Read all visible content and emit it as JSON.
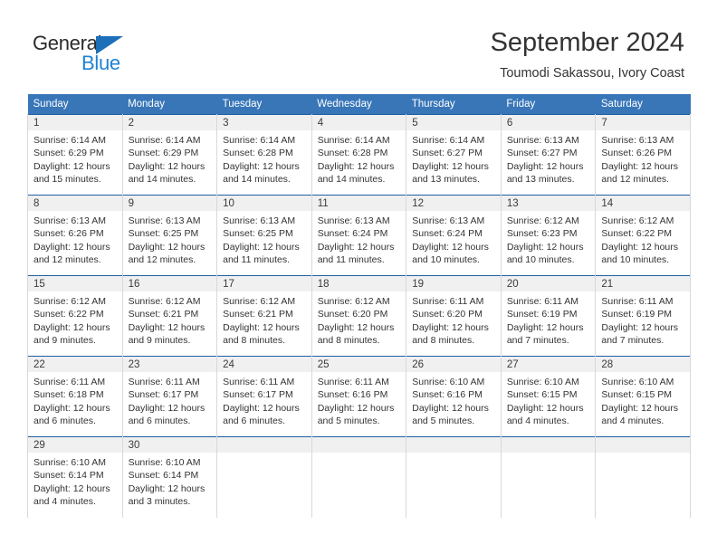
{
  "brand": {
    "name_part1": "General",
    "name_part2": "Blue",
    "color_dark": "#2b2b2b",
    "color_blue": "#2083d4",
    "triangle_color": "#1c6fb8"
  },
  "header": {
    "title": "September 2024",
    "subtitle": "Toumodi Sakassou, Ivory Coast"
  },
  "theme": {
    "header_row_bg": "#3876b8",
    "header_row_text": "#ffffff",
    "daynum_bg": "#f0f0f0",
    "cell_border": "#d8d8d8",
    "week_top_border": "#1f5fa0"
  },
  "weekday_headers": [
    "Sunday",
    "Monday",
    "Tuesday",
    "Wednesday",
    "Thursday",
    "Friday",
    "Saturday"
  ],
  "weeks": [
    [
      {
        "day": "1",
        "sunrise": "Sunrise: 6:14 AM",
        "sunset": "Sunset: 6:29 PM",
        "daylight1": "Daylight: 12 hours",
        "daylight2": "and 15 minutes."
      },
      {
        "day": "2",
        "sunrise": "Sunrise: 6:14 AM",
        "sunset": "Sunset: 6:29 PM",
        "daylight1": "Daylight: 12 hours",
        "daylight2": "and 14 minutes."
      },
      {
        "day": "3",
        "sunrise": "Sunrise: 6:14 AM",
        "sunset": "Sunset: 6:28 PM",
        "daylight1": "Daylight: 12 hours",
        "daylight2": "and 14 minutes."
      },
      {
        "day": "4",
        "sunrise": "Sunrise: 6:14 AM",
        "sunset": "Sunset: 6:28 PM",
        "daylight1": "Daylight: 12 hours",
        "daylight2": "and 14 minutes."
      },
      {
        "day": "5",
        "sunrise": "Sunrise: 6:14 AM",
        "sunset": "Sunset: 6:27 PM",
        "daylight1": "Daylight: 12 hours",
        "daylight2": "and 13 minutes."
      },
      {
        "day": "6",
        "sunrise": "Sunrise: 6:13 AM",
        "sunset": "Sunset: 6:27 PM",
        "daylight1": "Daylight: 12 hours",
        "daylight2": "and 13 minutes."
      },
      {
        "day": "7",
        "sunrise": "Sunrise: 6:13 AM",
        "sunset": "Sunset: 6:26 PM",
        "daylight1": "Daylight: 12 hours",
        "daylight2": "and 12 minutes."
      }
    ],
    [
      {
        "day": "8",
        "sunrise": "Sunrise: 6:13 AM",
        "sunset": "Sunset: 6:26 PM",
        "daylight1": "Daylight: 12 hours",
        "daylight2": "and 12 minutes."
      },
      {
        "day": "9",
        "sunrise": "Sunrise: 6:13 AM",
        "sunset": "Sunset: 6:25 PM",
        "daylight1": "Daylight: 12 hours",
        "daylight2": "and 12 minutes."
      },
      {
        "day": "10",
        "sunrise": "Sunrise: 6:13 AM",
        "sunset": "Sunset: 6:25 PM",
        "daylight1": "Daylight: 12 hours",
        "daylight2": "and 11 minutes."
      },
      {
        "day": "11",
        "sunrise": "Sunrise: 6:13 AM",
        "sunset": "Sunset: 6:24 PM",
        "daylight1": "Daylight: 12 hours",
        "daylight2": "and 11 minutes."
      },
      {
        "day": "12",
        "sunrise": "Sunrise: 6:13 AM",
        "sunset": "Sunset: 6:24 PM",
        "daylight1": "Daylight: 12 hours",
        "daylight2": "and 10 minutes."
      },
      {
        "day": "13",
        "sunrise": "Sunrise: 6:12 AM",
        "sunset": "Sunset: 6:23 PM",
        "daylight1": "Daylight: 12 hours",
        "daylight2": "and 10 minutes."
      },
      {
        "day": "14",
        "sunrise": "Sunrise: 6:12 AM",
        "sunset": "Sunset: 6:22 PM",
        "daylight1": "Daylight: 12 hours",
        "daylight2": "and 10 minutes."
      }
    ],
    [
      {
        "day": "15",
        "sunrise": "Sunrise: 6:12 AM",
        "sunset": "Sunset: 6:22 PM",
        "daylight1": "Daylight: 12 hours",
        "daylight2": "and 9 minutes."
      },
      {
        "day": "16",
        "sunrise": "Sunrise: 6:12 AM",
        "sunset": "Sunset: 6:21 PM",
        "daylight1": "Daylight: 12 hours",
        "daylight2": "and 9 minutes."
      },
      {
        "day": "17",
        "sunrise": "Sunrise: 6:12 AM",
        "sunset": "Sunset: 6:21 PM",
        "daylight1": "Daylight: 12 hours",
        "daylight2": "and 8 minutes."
      },
      {
        "day": "18",
        "sunrise": "Sunrise: 6:12 AM",
        "sunset": "Sunset: 6:20 PM",
        "daylight1": "Daylight: 12 hours",
        "daylight2": "and 8 minutes."
      },
      {
        "day": "19",
        "sunrise": "Sunrise: 6:11 AM",
        "sunset": "Sunset: 6:20 PM",
        "daylight1": "Daylight: 12 hours",
        "daylight2": "and 8 minutes."
      },
      {
        "day": "20",
        "sunrise": "Sunrise: 6:11 AM",
        "sunset": "Sunset: 6:19 PM",
        "daylight1": "Daylight: 12 hours",
        "daylight2": "and 7 minutes."
      },
      {
        "day": "21",
        "sunrise": "Sunrise: 6:11 AM",
        "sunset": "Sunset: 6:19 PM",
        "daylight1": "Daylight: 12 hours",
        "daylight2": "and 7 minutes."
      }
    ],
    [
      {
        "day": "22",
        "sunrise": "Sunrise: 6:11 AM",
        "sunset": "Sunset: 6:18 PM",
        "daylight1": "Daylight: 12 hours",
        "daylight2": "and 6 minutes."
      },
      {
        "day": "23",
        "sunrise": "Sunrise: 6:11 AM",
        "sunset": "Sunset: 6:17 PM",
        "daylight1": "Daylight: 12 hours",
        "daylight2": "and 6 minutes."
      },
      {
        "day": "24",
        "sunrise": "Sunrise: 6:11 AM",
        "sunset": "Sunset: 6:17 PM",
        "daylight1": "Daylight: 12 hours",
        "daylight2": "and 6 minutes."
      },
      {
        "day": "25",
        "sunrise": "Sunrise: 6:11 AM",
        "sunset": "Sunset: 6:16 PM",
        "daylight1": "Daylight: 12 hours",
        "daylight2": "and 5 minutes."
      },
      {
        "day": "26",
        "sunrise": "Sunrise: 6:10 AM",
        "sunset": "Sunset: 6:16 PM",
        "daylight1": "Daylight: 12 hours",
        "daylight2": "and 5 minutes."
      },
      {
        "day": "27",
        "sunrise": "Sunrise: 6:10 AM",
        "sunset": "Sunset: 6:15 PM",
        "daylight1": "Daylight: 12 hours",
        "daylight2": "and 4 minutes."
      },
      {
        "day": "28",
        "sunrise": "Sunrise: 6:10 AM",
        "sunset": "Sunset: 6:15 PM",
        "daylight1": "Daylight: 12 hours",
        "daylight2": "and 4 minutes."
      }
    ],
    [
      {
        "day": "29",
        "sunrise": "Sunrise: 6:10 AM",
        "sunset": "Sunset: 6:14 PM",
        "daylight1": "Daylight: 12 hours",
        "daylight2": "and 4 minutes."
      },
      {
        "day": "30",
        "sunrise": "Sunrise: 6:10 AM",
        "sunset": "Sunset: 6:14 PM",
        "daylight1": "Daylight: 12 hours",
        "daylight2": "and 3 minutes."
      },
      {
        "day": "",
        "sunrise": "",
        "sunset": "",
        "daylight1": "",
        "daylight2": ""
      },
      {
        "day": "",
        "sunrise": "",
        "sunset": "",
        "daylight1": "",
        "daylight2": ""
      },
      {
        "day": "",
        "sunrise": "",
        "sunset": "",
        "daylight1": "",
        "daylight2": ""
      },
      {
        "day": "",
        "sunrise": "",
        "sunset": "",
        "daylight1": "",
        "daylight2": ""
      },
      {
        "day": "",
        "sunrise": "",
        "sunset": "",
        "daylight1": "",
        "daylight2": ""
      }
    ]
  ]
}
